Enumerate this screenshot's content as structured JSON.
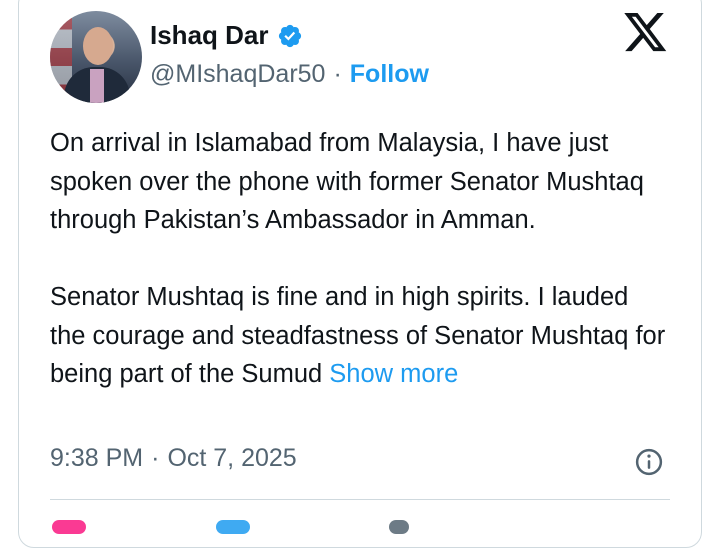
{
  "author": {
    "name": "Ishaq Dar",
    "handle": "@MIshaqDar50",
    "follow_label": "Follow",
    "separator": "·",
    "verified_color": "#1d9bf0"
  },
  "post": {
    "paragraph_1": "On arrival in Islamabad from Malaysia, I have just spoken over the phone with former Senator Mushtaq through Pakistan’s Ambassador in Amman.",
    "paragraph_2": "Senator Mushtaq is fine and in high spirits. I lauded the courage and steadfastness of Senator Mushtaq for being part of the Sumud",
    "show_more_label": "Show more"
  },
  "meta": {
    "time": "9:38 PM",
    "separator": "·",
    "date": "Oct 7, 2025"
  },
  "icons": {
    "brand": "x-logo-icon",
    "verified": "verified-badge-icon",
    "info": "info-icon",
    "like": "heart-icon",
    "reply": "reply-icon",
    "copy": "copy-link-icon"
  },
  "colors": {
    "accent": "#1d9bf0",
    "text": "#0f1419",
    "muted": "#536471",
    "border": "#cfd9de",
    "like": "#f91880"
  }
}
